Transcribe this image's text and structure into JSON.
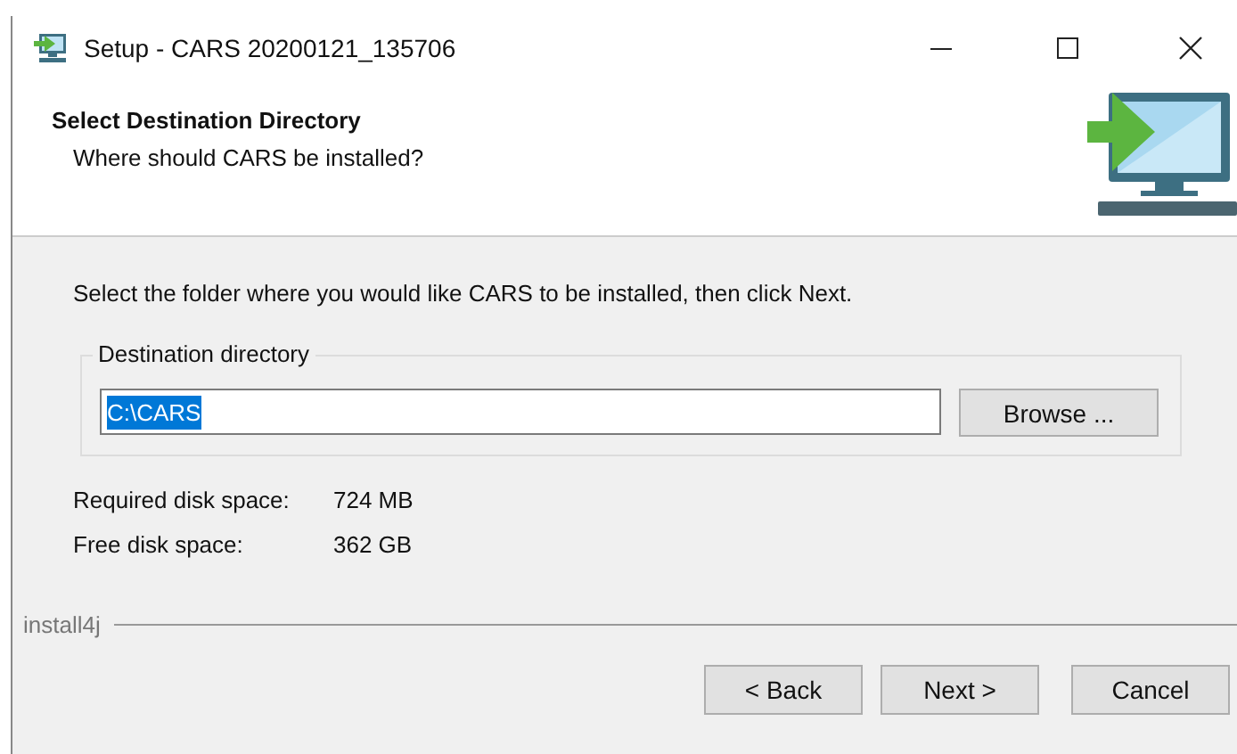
{
  "window": {
    "title": "Setup - CARS 20200121_135706"
  },
  "header": {
    "title": "Select Destination Directory",
    "subtitle": "Where should CARS be installed?"
  },
  "instruction": "Select the folder where you would like CARS to be installed, then click Next.",
  "destination": {
    "label": "Destination directory",
    "value": "C:\\CARS",
    "text_selected": true,
    "browse": "Browse ..."
  },
  "disk_info": [
    {
      "label": "Required disk space:",
      "value": "724 MB"
    },
    {
      "label": "Free disk space:",
      "value": "362 GB"
    }
  ],
  "brand": "install4j",
  "buttons": [
    "< Back",
    "Next >",
    "Cancel"
  ]
}
